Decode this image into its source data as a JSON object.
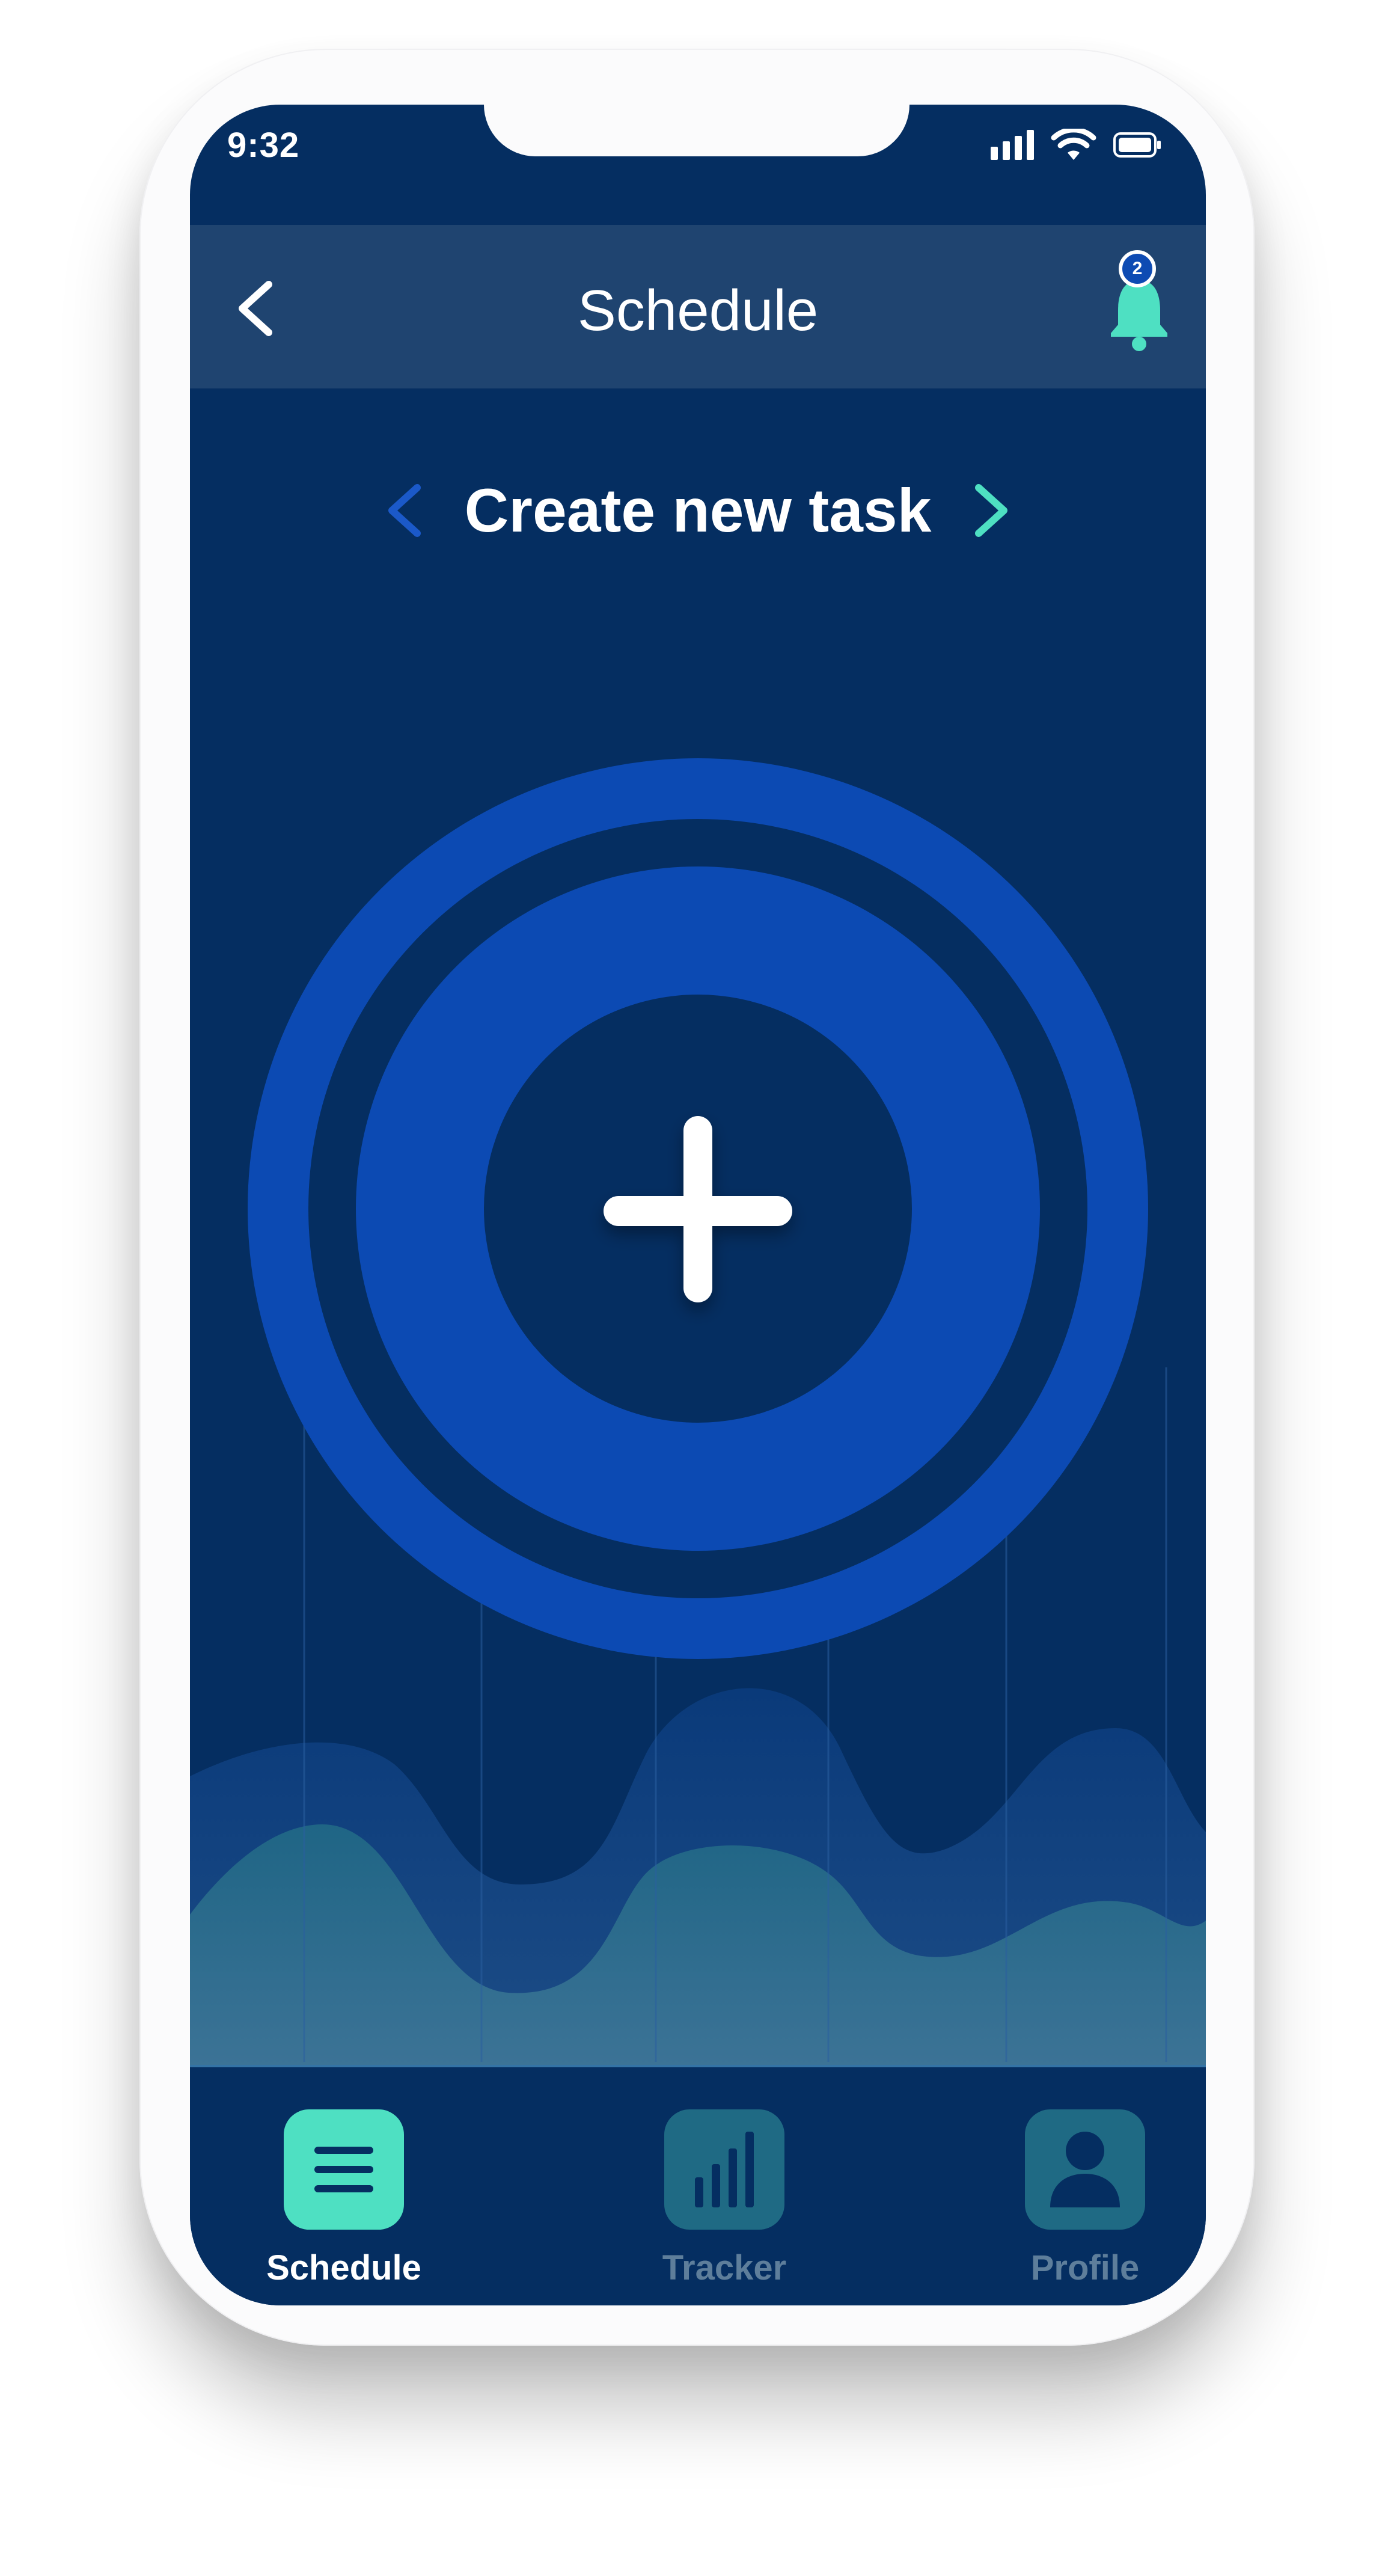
{
  "status_bar": {
    "time": "9:32",
    "icons": [
      "cellular-signal-icon",
      "wifi-icon",
      "battery-icon"
    ]
  },
  "header": {
    "title": "Schedule",
    "back_icon": "chevron-left-icon",
    "notification_icon": "bell-icon",
    "notification_count": "2"
  },
  "task_nav": {
    "title": "Create new task",
    "prev_icon": "chevron-left-icon",
    "next_icon": "chevron-right-icon"
  },
  "main_action": {
    "icon": "plus-icon"
  },
  "bottom_nav": {
    "items": [
      {
        "label": "Schedule",
        "icon": "menu-list-icon",
        "active": true
      },
      {
        "label": "Tracker",
        "icon": "bar-chart-icon",
        "active": false
      },
      {
        "label": "Profile",
        "icon": "user-icon",
        "active": false
      }
    ]
  },
  "colors": {
    "screen_background": "#052e61",
    "header_background": "#1f4470",
    "ring_blue": "#0c4ab3",
    "accent_teal": "#4ee0c2",
    "inactive_tile": "#1f6a84",
    "inactive_label": "#5e7e9b",
    "prev_chevron": "#1b59c9"
  }
}
